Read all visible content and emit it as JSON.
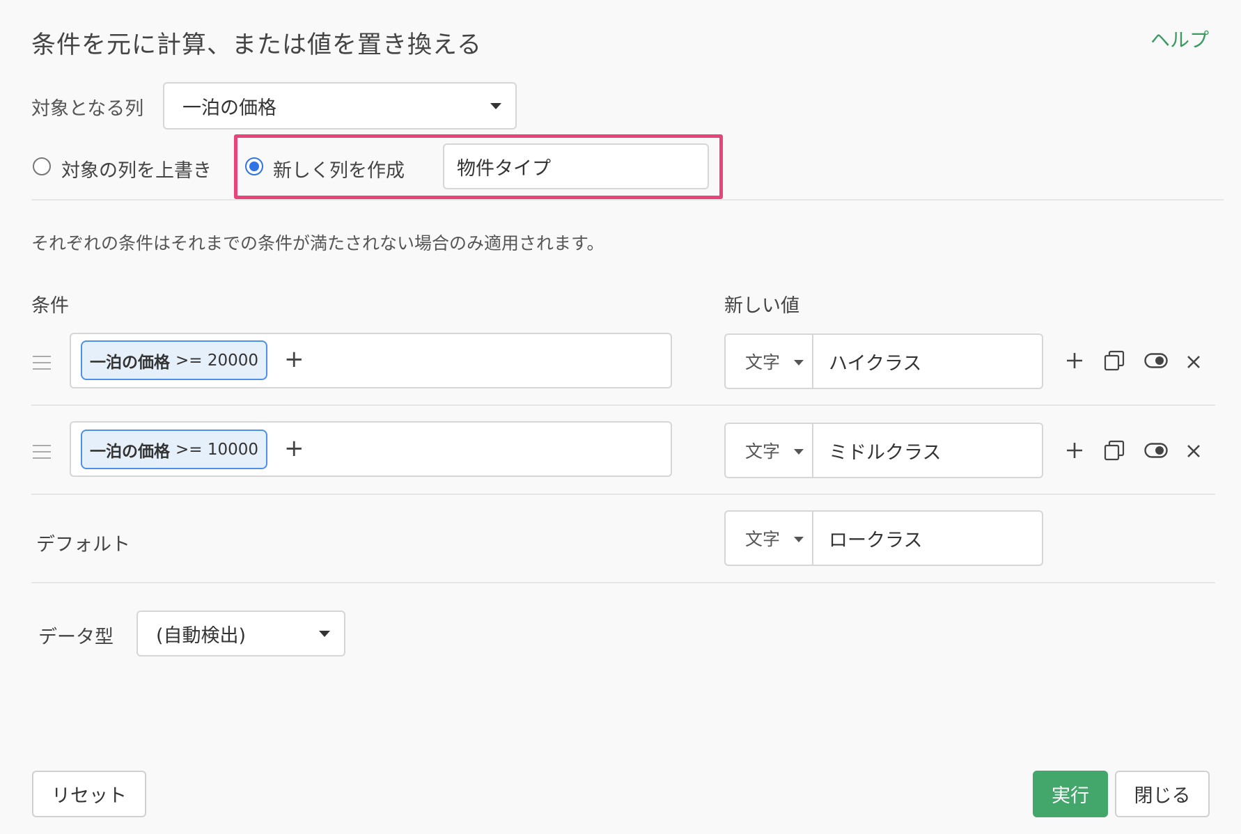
{
  "header": {
    "title": "条件を元に計算、または値を置き換える",
    "help_label": "ヘルプ"
  },
  "target": {
    "label": "対象となる列",
    "selected": "一泊の価格"
  },
  "mode": {
    "overwrite_label": "対象の列を上書き",
    "create_label": "新しく列を作成",
    "selected": "create",
    "new_column_value": "物件タイプ"
  },
  "description": "それぞれの条件はそれまでの条件が満たされない場合のみ適用されます。",
  "columns": {
    "condition_header": "条件",
    "new_value_header": "新しい値"
  },
  "rules": [
    {
      "chip_field": "一泊の価格",
      "chip_expr": ">= 20000",
      "type": "文字",
      "value": "ハイクラス"
    },
    {
      "chip_field": "一泊の価格",
      "chip_expr": ">= 10000",
      "type": "文字",
      "value": "ミドルクラス"
    }
  ],
  "default": {
    "label": "デフォルト",
    "type": "文字",
    "value": "ロークラス"
  },
  "datatype": {
    "label": "データ型",
    "selected": "(自動検出)"
  },
  "footer": {
    "reset_label": "リセット",
    "run_label": "実行",
    "close_label": "閉じる"
  },
  "colors": {
    "accent": "#43a66b",
    "highlight": "#e7457a",
    "chip_border": "#4d90ea",
    "radio": "#2e74e6"
  }
}
